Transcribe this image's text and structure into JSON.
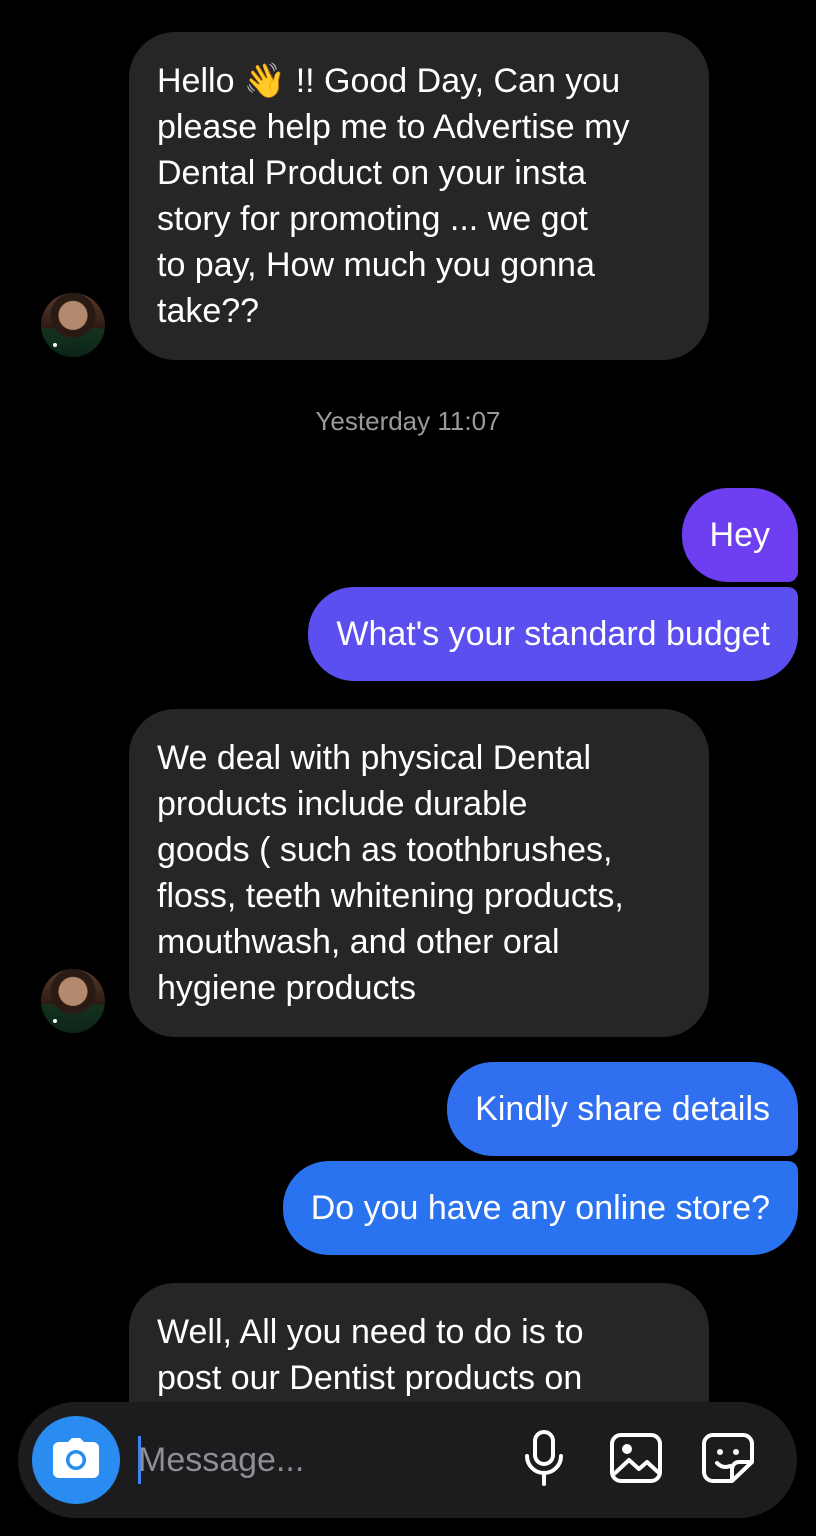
{
  "messages": [
    {
      "text": "Hello 👋 !! Good Day, Can you\nplease help me to Advertise my\nDental Product on your insta\nstory for promoting ... we got\nto pay, How much you gonna\ntake??"
    },
    {
      "text": "Yesterday 11:07"
    },
    {
      "text": "Hey"
    },
    {
      "text": "What's your standard budget"
    },
    {
      "text": "We deal with physical Dental\nproducts include durable\ngoods ( such as toothbrushes,\nfloss, teeth whitening products,\nmouthwash, and other oral\nhygiene products"
    },
    {
      "text": "Kindly share details"
    },
    {
      "text": "Do you have any online store?"
    },
    {
      "text": "Well, All you need to do is to\npost our Dentist products on"
    }
  ],
  "composer": {
    "placeholder": "Message..."
  },
  "icons": [
    "camera-icon",
    "microphone-icon",
    "gallery-icon",
    "sticker-icon"
  ],
  "colors": {
    "background": "#000000",
    "incoming_bubble": "#262626",
    "outgoing_purple": "#6e3ff0",
    "outgoing_blue": "#2f6ff0",
    "camera_button": "#2a8cf0",
    "timestamp": "#9a9a9a"
  }
}
